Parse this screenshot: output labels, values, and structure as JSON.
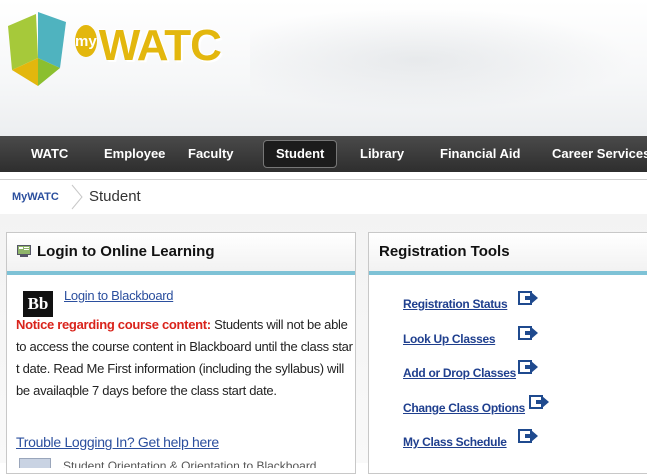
{
  "logo": {
    "prefix": "my",
    "name": "WATC"
  },
  "nav": {
    "items": [
      "WATC",
      "Employee",
      "Faculty",
      "Student",
      "Library",
      "Financial Aid",
      "Career Services"
    ],
    "active": "Student"
  },
  "breadcrumb": {
    "home": "MyWATC",
    "current": "Student"
  },
  "login_panel": {
    "title": "Login to Online Learning",
    "blackboard_logo": "Bb",
    "blackboard_link": "Login to Blackboard",
    "notice_lead": "Notice regarding course content:",
    "notice_body": " Students will not be able to access the course content in Blackboard until the class start date. Read Me First information (including the syllabus) will be availaqble 7 days before the class start date.",
    "trouble_link": "Trouble Logging In? Get help here",
    "next_item_partial": "Student Orientation & Orientation to Blackboard"
  },
  "registration_panel": {
    "title": "Registration Tools",
    "links": [
      "Registration Status",
      "Look Up Classes",
      "Add or Drop Classes",
      "Change Class Options",
      "My Class Schedule"
    ]
  },
  "colors": {
    "nav_bg": "#333333",
    "panel_accent": "#7ec2d6",
    "link": "#2b4f9e",
    "notice_red": "#d9231b",
    "logo_gold": "#e3b70d",
    "logo_teal": "#4fb3bf",
    "logo_green": "#a6c93a"
  },
  "icons": {
    "logo_mark": "watc-butterfly-icon",
    "panel_icon": "monitor-icon",
    "registration_arrow": "external-arrow-icon",
    "crumb_separator": "chevron-right-icon"
  }
}
